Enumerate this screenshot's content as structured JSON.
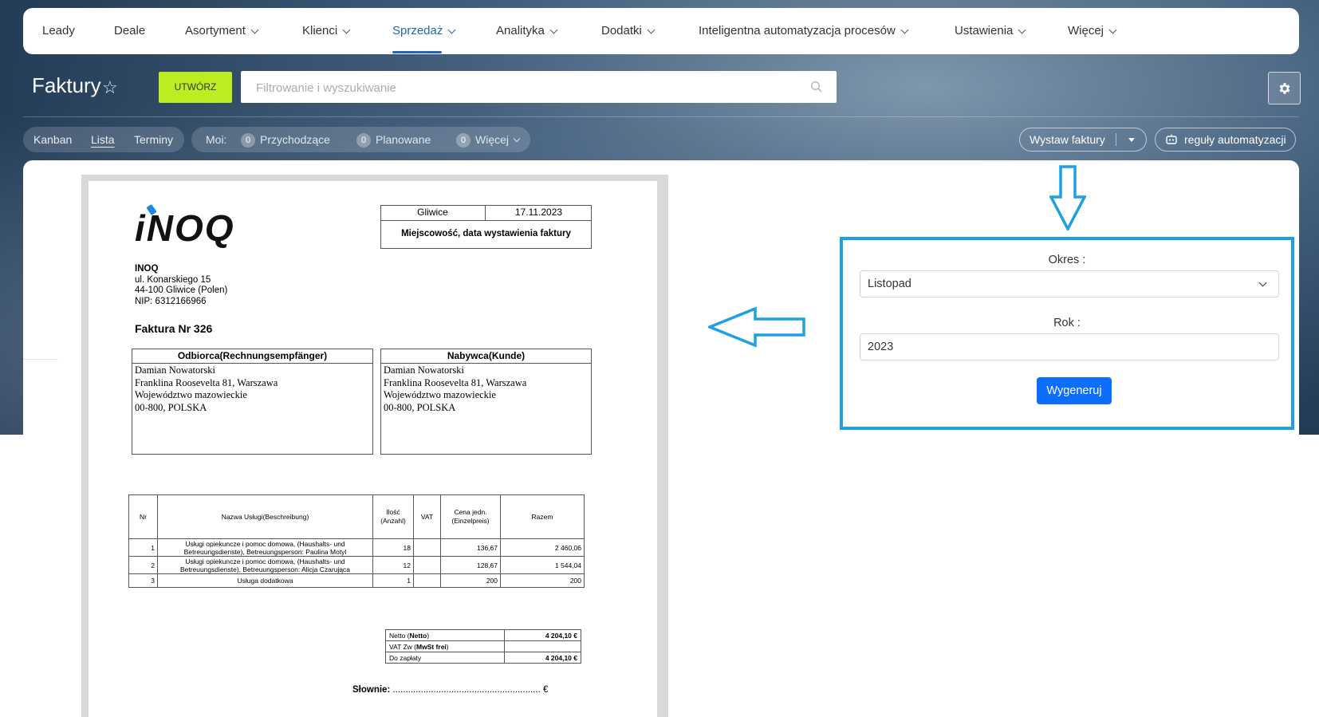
{
  "nav": {
    "items": [
      {
        "label": "Leady"
      },
      {
        "label": "Deale"
      },
      {
        "label": "Asortyment"
      },
      {
        "label": "Klienci"
      },
      {
        "label": "Sprzedaż"
      },
      {
        "label": "Analityka"
      },
      {
        "label": "Dodatki"
      },
      {
        "label": "Inteligentna automatyzacja procesów"
      },
      {
        "label": "Ustawienia"
      },
      {
        "label": "Więcej"
      }
    ],
    "active": "Sprzedaż"
  },
  "header": {
    "title": "Faktury",
    "create_label": "UTWÓRZ",
    "search_placeholder": "Filtrowanie i wyszukiwanie"
  },
  "views": {
    "items": [
      {
        "label": "Kanban"
      },
      {
        "label": "Lista"
      },
      {
        "label": "Terminy"
      }
    ],
    "active": "Lista"
  },
  "counters": {
    "my_label": "Moi:",
    "items": [
      {
        "count": "0",
        "label": "Przychodzące"
      },
      {
        "count": "0",
        "label": "Planowane"
      },
      {
        "count": "0",
        "label": "Więcej"
      }
    ]
  },
  "actions": {
    "issue_invoices": "Wystaw faktury",
    "automation_rules": "reguły automatyzacji"
  },
  "invoice": {
    "place": "Gliwice",
    "date": "17.11.2023",
    "place_date_caption": "Miejscowość, data wystawienia faktury",
    "logo_text": "iNOQ",
    "seller": {
      "name": "INOQ",
      "street": "ul. Konarskiego 15",
      "city": "44-100 Gliwice (Polen)",
      "nip": "NIP: 6312166966"
    },
    "number_title": "Faktura Nr 326",
    "recipient_header": "Odbiorca(Rechnungsempfänger)",
    "buyer_header": "Nabywca(Kunde)",
    "recipient": {
      "name": "Damian Nowatorski",
      "street": "Franklina Roosevelta 81, Warszawa",
      "region": "Województwo mazowieckie",
      "postal": "00-800, POLSKA"
    },
    "buyer": {
      "name": "Damian Nowatorski",
      "street": "Franklina Roosevelta 81, Warszawa",
      "region": "Województwo mazowieckie",
      "postal": "00-800, POLSKA"
    },
    "columns": {
      "nr": "Nr",
      "name": "Nazwa Usługi(Beschreibung)",
      "qty1": "Ilość",
      "qty2": "(Anzahl)",
      "vat": "VAT",
      "price1": "Cena jedn.",
      "price2": "(Einzelpreis)",
      "total": "Razem"
    },
    "rows": [
      {
        "nr": "1",
        "desc1": "Usługi opiekuncze i pomoc domowa, (Haushalts- und",
        "desc2": "Betreuungsdienste), Betreuungsperson: Paulina Motyl",
        "qty": "18",
        "vat": "",
        "price": "136,67",
        "total": "2 460,06"
      },
      {
        "nr": "2",
        "desc1": "Usługi opiekuncze i pomoc domowa, (Haushalts- und",
        "desc2": "Betreuungsdienste), Betreuungsperson: Alicja Czarująca",
        "qty": "12",
        "vat": "",
        "price": "128,67",
        "total": "1 544,04"
      },
      {
        "nr": "3",
        "desc1": "Usługa dodatkowa",
        "desc2": "",
        "qty": "1",
        "vat": "",
        "price": "200",
        "total": "200"
      }
    ],
    "totals": {
      "netto_label_a": "Netto (",
      "netto_label_b": "Netto",
      "netto_label_c": ")",
      "netto_value": "4 204,10 €",
      "vat_label_a": "VAT Zw (",
      "vat_label_b": "MwSt frei",
      "vat_label_c": ")",
      "vat_value": "",
      "due_label": "Do zapłaty",
      "due_value": "4 204,10 €"
    },
    "words_label": "Słownie:",
    "words_dots": "..........................................................",
    "words_currency": "€"
  },
  "form": {
    "period_label": "Okres :",
    "period_value": "Listopad",
    "year_label": "Rok :",
    "year_value": "2023",
    "generate_label": "Wygeneruj"
  },
  "colors": {
    "accent": "#2067b0",
    "create_button": "#bbed21",
    "annotation": "#1ea0e3",
    "primary_button": "#0d6efd"
  }
}
